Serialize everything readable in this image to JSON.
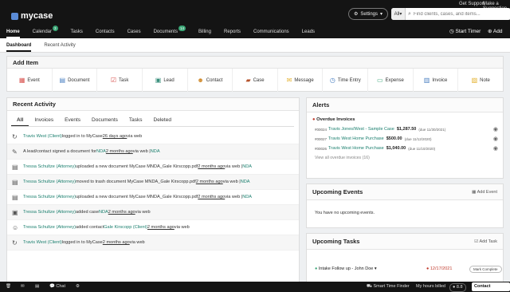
{
  "header": {
    "logo_text": "mycase",
    "get_support": "Get Support",
    "make_suggestion": "Make a Suggestion",
    "settings_label": "Settings",
    "search_scope": "All",
    "search_placeholder": "Find clients, cases, and items...",
    "start_timer": "Start Timer",
    "add_item": "Add Item"
  },
  "nav": {
    "home": "Home",
    "calendar": "Calendar",
    "calendar_badge": "3",
    "tasks": "Tasks",
    "contacts": "Contacts",
    "cases": "Cases",
    "documents": "Documents",
    "documents_badge": "14",
    "billing": "Billing",
    "reports": "Reports",
    "communications": "Communications",
    "leads": "Leads"
  },
  "subnav": {
    "dashboard": "Dashboard",
    "recent_activity": "Recent Activity"
  },
  "add_item": {
    "title": "Add Item",
    "event": "Event",
    "document": "Document",
    "task": "Task",
    "lead": "Lead",
    "contact": "Contact",
    "case": "Case",
    "message": "Message",
    "time_entry": "Time Entry",
    "expense": "Expense",
    "invoice": "Invoice",
    "note": "Note"
  },
  "recent_activity": {
    "title": "Recent Activity",
    "tabs": [
      "All",
      "Invoices",
      "Events",
      "Documents",
      "Tasks",
      "Deleted"
    ],
    "rows": [
      {
        "actor": "Travis West (Client)",
        "text": " logged in to MyCase ",
        "time": "26 days ago",
        "suffix": " via web",
        "icon": "↻"
      },
      {
        "actor": "",
        "text": "A lead/contact signed a document for ",
        "target": "NDA",
        "time": "2 months ago",
        "suffix": " via web | ",
        "tail": "NDA",
        "icon": "✎"
      },
      {
        "actor": "Tressa Schultze (Attorney)",
        "text": " uploaded a new document MyCase MNDA_Gale Kirscopp.pdf ",
        "time": "2 months ago",
        "suffix": " via web | ",
        "tail": "NDA",
        "icon": "▤"
      },
      {
        "actor": "Tressa Schultze (Attorney)",
        "text": " moved to trash document MyCase MNDA_Gale Kirscopp.pdf ",
        "time": "2 months ago",
        "suffix": " via web | ",
        "tail": "NDA",
        "icon": "▤"
      },
      {
        "actor": "Tressa Schultze (Attorney)",
        "text": " uploaded a new document MyCase MNDA_Gale Kirscopp.pdf ",
        "time": "2 months ago",
        "suffix": " via web | ",
        "tail": "NDA",
        "icon": "▤"
      },
      {
        "actor": "Tressa Schultze (Attorney)",
        "text": " added case ",
        "target": "NDA",
        "time": "2 months ago",
        "suffix": " via web",
        "icon": "▣"
      },
      {
        "actor": "Tressa Schultze (Attorney)",
        "text": " added contact ",
        "target": "Gale Kirscopp (Client)",
        "time": "2 months ago",
        "suffix": " via web",
        "icon": "☺"
      },
      {
        "actor": "Travis West (Client)",
        "text": " logged in to MyCase ",
        "time": "2 months ago",
        "suffix": " via web",
        "icon": "↻"
      }
    ]
  },
  "alerts": {
    "title": "Alerts",
    "overdue_title": "Overdue Invoices",
    "invoices": [
      {
        "id": "#00024",
        "name": "Travis Jones/West - Sample Case",
        "amount": "$1,287.50",
        "due": "(due 11/30/2021)"
      },
      {
        "id": "#00027",
        "name": "Travis West Home Purchase",
        "amount": "$500.00",
        "due": "(due 11/12/2020)"
      },
      {
        "id": "#00026",
        "name": "Travis West Home Purchase",
        "amount": "$1,040.00",
        "due": "(due 11/10/2020)"
      }
    ],
    "view_all": "View all overdue invoices (16)"
  },
  "events": {
    "title": "Upcoming Events",
    "add_label": "Add Event",
    "empty": "You have no upcoming events."
  },
  "tasks": {
    "title": "Upcoming Tasks",
    "add_label": "Add Task",
    "item": "Intake Follow up - John Doe",
    "date": "12/17/2021",
    "mark_complete": "Mark Complete"
  },
  "bottombar": {
    "chat": "Chat",
    "smart_time_finder": "Smart Time Finder",
    "my_hours": "My hours billed",
    "hours_value": "8.8",
    "contact_support": "Contact Support"
  }
}
